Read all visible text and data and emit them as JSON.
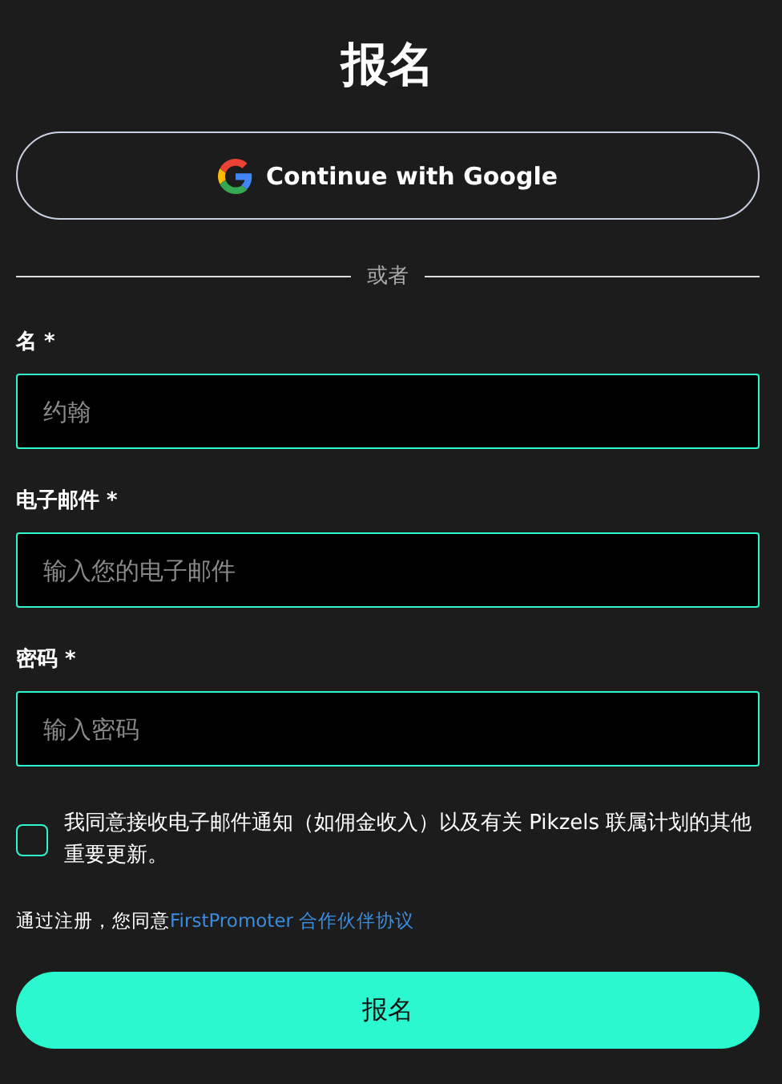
{
  "title": "报名",
  "google_button": {
    "label": "Continue with Google"
  },
  "divider": {
    "label": "或者"
  },
  "fields": [
    {
      "label": "名 *",
      "placeholder": "约翰"
    },
    {
      "label": "电子邮件 *",
      "placeholder": "输入您的电子邮件"
    },
    {
      "label": "密码 *",
      "placeholder": "输入密码"
    }
  ],
  "consent": {
    "checked": false,
    "label": "我同意接收电子邮件通知（如佣金收入）以及有关 Pikzels 联属计划的其他重要更新。"
  },
  "agreement": {
    "text": "通过注册，您同意",
    "link": "FirstPromoter 合作伙伴协议"
  },
  "submit_button": {
    "label": "报名"
  }
}
